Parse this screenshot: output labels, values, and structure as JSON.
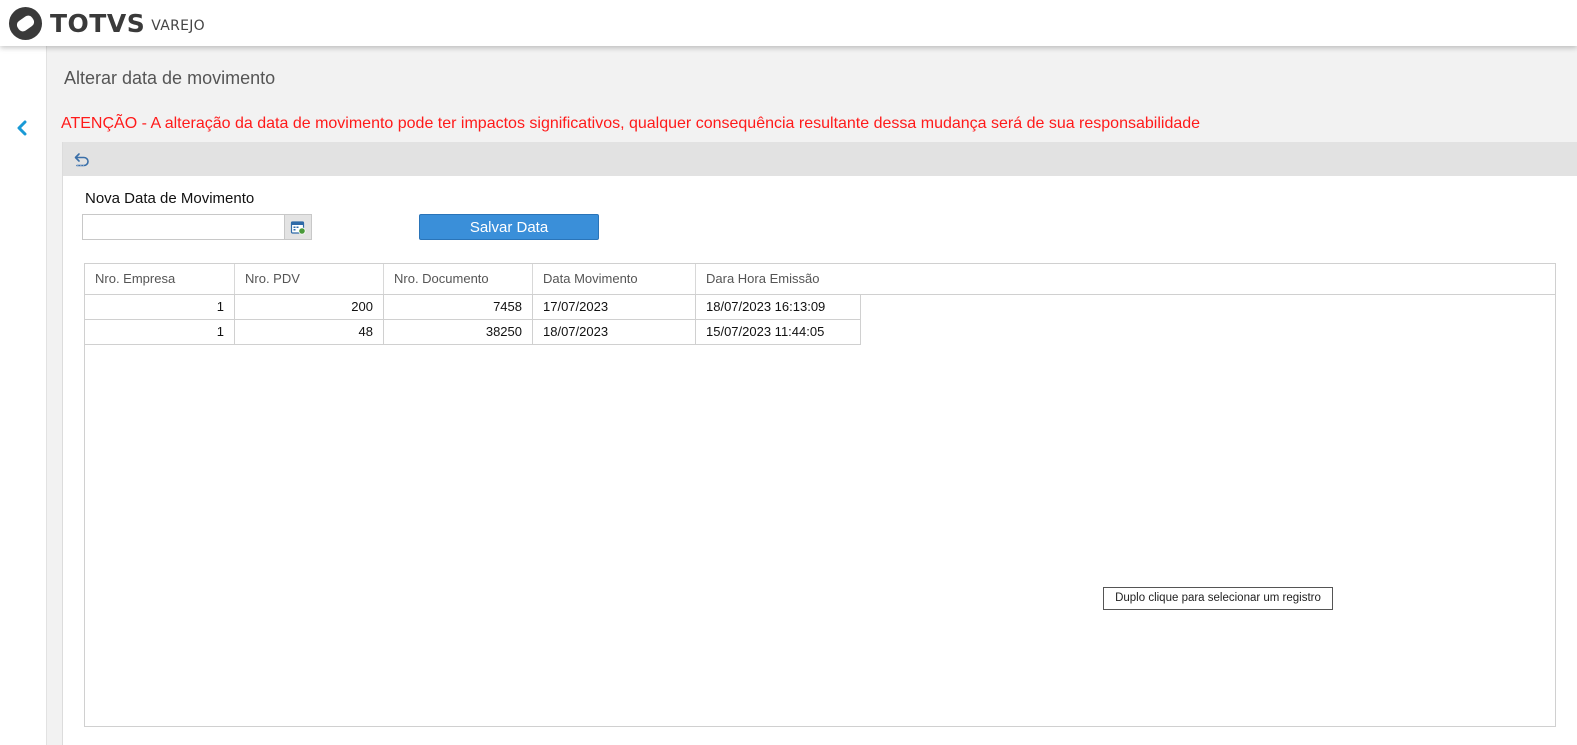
{
  "header": {
    "brand": "TOTVS",
    "brand_sub": "VAREJO",
    "logo_icon": "totvs-logo-icon"
  },
  "sidebar": {
    "back_icon": "chevron-left-icon"
  },
  "page": {
    "title": "Alterar data de movimento",
    "warning": "ATENÇÃO - A alteração da data de movimento pode ter impactos significativos, qualquer consequência resultante dessa mudança será de sua responsabilidade"
  },
  "toolbar": {
    "undo_icon": "undo-icon"
  },
  "form": {
    "date_label": "Nova Data de Movimento",
    "date_value": "",
    "date_placeholder": "",
    "calendar_icon": "calendar-icon",
    "save_label": "Salvar Data"
  },
  "grid": {
    "columns": [
      "Nro. Empresa",
      "Nro. PDV",
      "Nro. Documento",
      "Data Movimento",
      "Dara Hora Emissão"
    ],
    "rows": [
      [
        "1",
        "200",
        "7458",
        "17/07/2023",
        "18/07/2023 16:13:09"
      ],
      [
        "1",
        "48",
        "38250",
        "18/07/2023",
        "15/07/2023 11:44:05"
      ]
    ]
  },
  "tooltip": "Duplo clique para selecionar um registro",
  "colors": {
    "accent": "#3a8fd9",
    "warning": "#ff1a1a",
    "back_arrow": "#1a9ad6",
    "toolbar_bg": "#e2e2e2",
    "content_bg": "#f2f2f2"
  }
}
